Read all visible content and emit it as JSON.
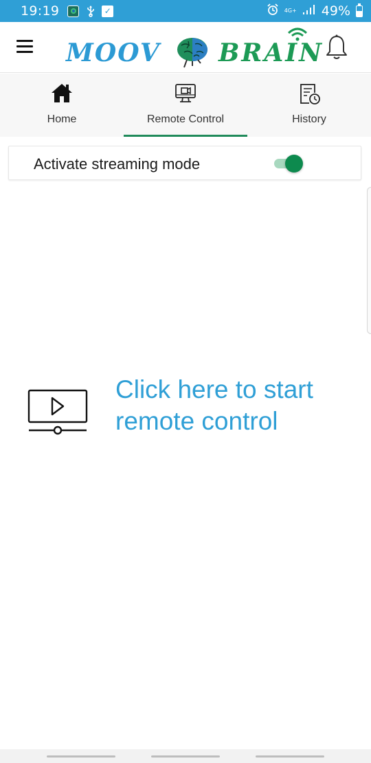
{
  "status_bar": {
    "time": "19:19",
    "network_label": "4G+",
    "signal_bars": "..ıl",
    "battery": "49%"
  },
  "header": {
    "logo_left": "MOOV",
    "logo_right": "BRAIN",
    "brand_colors": {
      "blue": "#2c9ad4",
      "green": "#1c9a55"
    }
  },
  "tabs": [
    {
      "label": "Home",
      "icon": "home-icon",
      "selected": false
    },
    {
      "label": "Remote Control",
      "icon": "monitor-camera-icon",
      "selected": true
    },
    {
      "label": "History",
      "icon": "history-icon",
      "selected": false
    }
  ],
  "streaming": {
    "label": "Activate streaming mode",
    "enabled": true
  },
  "remote": {
    "start_label": "Click here to start remote control",
    "accent": "#2f9fd6"
  }
}
